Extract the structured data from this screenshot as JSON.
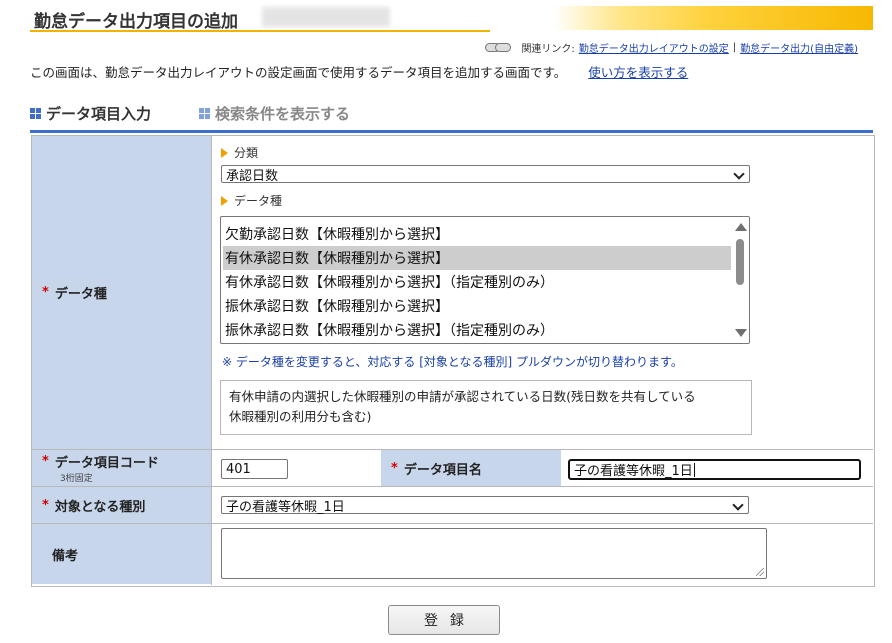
{
  "header": {
    "title": "勤怠データ出力項目の追加",
    "related_label": "関連リンク:",
    "related_links": [
      "勤怠データ出力レイアウトの設定",
      "勤怠データ出力(自由定義)"
    ],
    "separator": "|"
  },
  "description": {
    "text": "この画面は、勤怠データ出力レイアウトの設定画面で使用するデータ項目を追加する画面です。",
    "help_link": "使い方を表示する"
  },
  "tabs": [
    {
      "label": "データ項目入力",
      "active": true
    },
    {
      "label": "検索条件を表示する",
      "active": false
    }
  ],
  "form": {
    "data_type": {
      "label": "データ種",
      "required_mark": "*",
      "category_heading": "分類",
      "category_value": "承認日数",
      "type_heading": "データ種",
      "options": [
        "欠勤承認日数【休暇種別から選択】",
        "有休承認日数【休暇種別から選択】",
        "有休承認日数【休暇種別から選択】（指定種別のみ）",
        "振休承認日数【休暇種別から選択】",
        "振休承認日数【休暇種別から選択】（指定種別のみ）"
      ],
      "selected_index": 1,
      "note": "※ データ種を変更すると、対応する [対象となる種別] プルダウンが切り替わります。",
      "description_lines": [
        "有休申請の内選択した休暇種別の申請が承認されている日数(残日数を共有している",
        "休暇種別の利用分も含む)"
      ]
    },
    "item_code": {
      "label": "データ項目コード",
      "sublabel": "3桁固定",
      "required_mark": "*",
      "value": "401"
    },
    "item_name": {
      "label": "データ項目名",
      "required_mark": "*",
      "value": "子の看護等休暇_1日"
    },
    "target_type": {
      "label": "対象となる種別",
      "required_mark": "*",
      "value": "子の看護等休暇_1日"
    },
    "remarks": {
      "label": "備考",
      "value": ""
    }
  },
  "submit_label": "登録",
  "colors": {
    "label_bg": "#c8d6ec",
    "accent_blue": "#3a6fcf",
    "link": "#1a3fa8",
    "required": "#d40000",
    "title_gradient": "#ffd23f"
  }
}
